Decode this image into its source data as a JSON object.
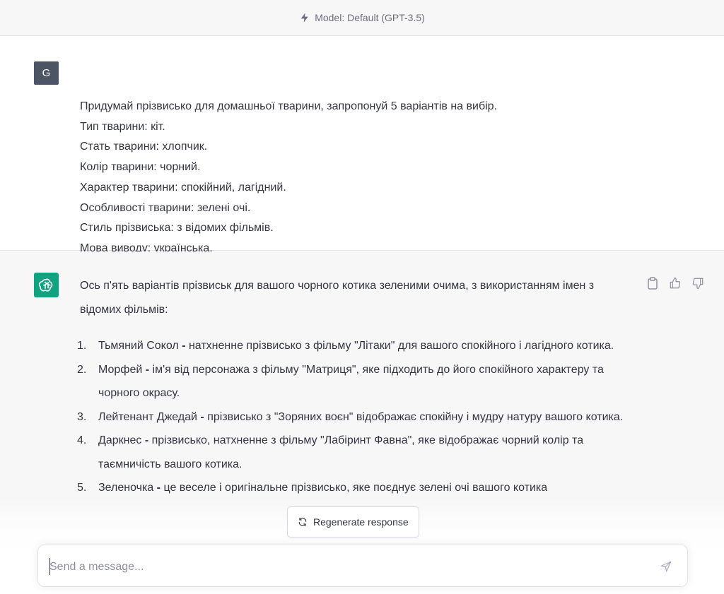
{
  "topbar": {
    "model_label": "Model: Default (GPT-3.5)"
  },
  "user_message": {
    "avatar_letter": "G",
    "lines": [
      "Придумай прізвисько для домашньої тварини, запропонуй 5 варіантів на вибір.",
      "Тип тварини: кіт.",
      "Стать тварини: хлопчик.",
      "Колір тварини: чорний.",
      "Характер тварини: спокійний, лагідний.",
      "Особливості тварини: зелені очі.",
      "Стиль прізвиська: з відомих фільмів.",
      "Мова виводу: українська."
    ]
  },
  "assistant_message": {
    "intro": "Ось п'ять варіантів прізвиськ для вашого чорного котика зеленими очима, з використанням імен з відомих фільмів:",
    "items": [
      {
        "num": "1.",
        "name": "Тьмяний Сокол",
        "sep": " - ",
        "desc": "натхненне прізвисько з фільму \"Літаки\" для вашого спокійного і лагідного котика."
      },
      {
        "num": "2.",
        "name": "Морфей",
        "sep": " - ",
        "desc": "ім'я від персонажа з фільму \"Матриця\", яке підходить до його спокійного характеру та чорного окрасу."
      },
      {
        "num": "3.",
        "name": "Лейтенант Джедай",
        "sep": " - ",
        "desc": "прізвисько з \"Зоряних воєн\" відображає спокійну і мудру натуру вашого котика."
      },
      {
        "num": "4.",
        "name": "Даркнес",
        "sep": " - ",
        "desc": "прізвисько, натхненне з фільму \"Лабіринт Фавна\", яке відображає чорний колір та таємничість вашого котика."
      },
      {
        "num": "5.",
        "name": "Зеленочка",
        "sep": " - ",
        "desc": "це веселе і оригінальне прізвисько, яке поєднує зелені очі вашого котика"
      }
    ]
  },
  "regenerate": {
    "label": "Regenerate response"
  },
  "composer": {
    "placeholder": "Send a message..."
  },
  "colors": {
    "accent": "#10a37f",
    "user_avatar": "#4b5563",
    "text": "#343541",
    "assistant_bg": "#f7f7f8"
  }
}
